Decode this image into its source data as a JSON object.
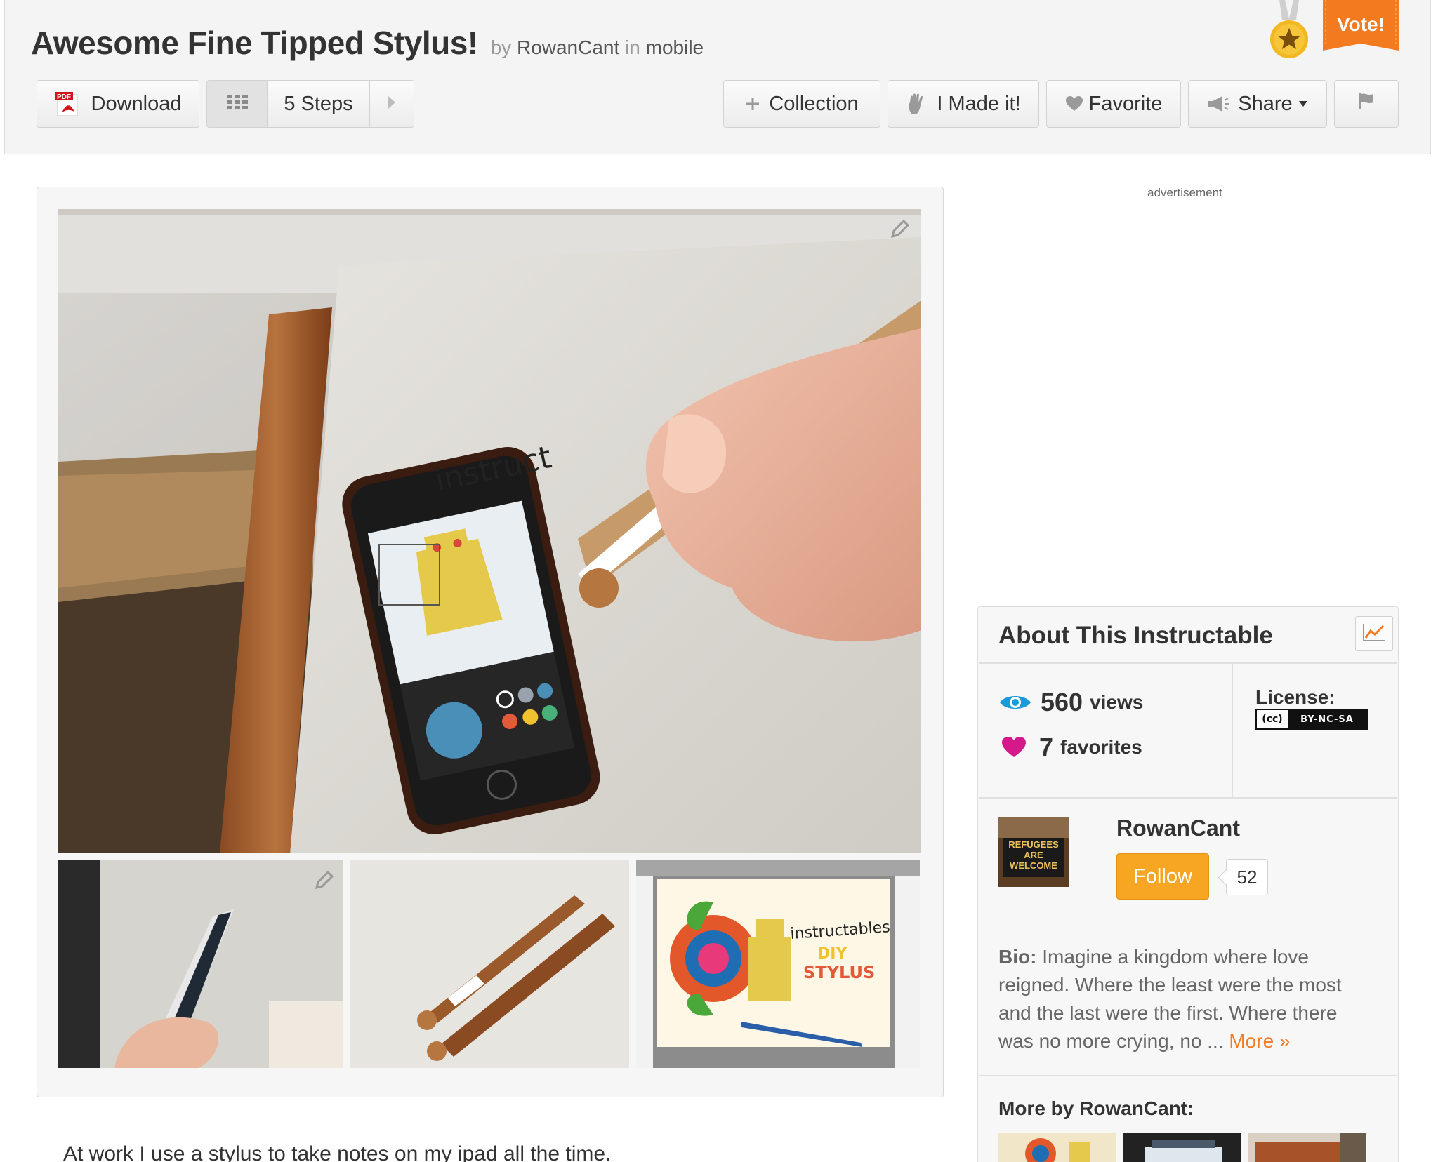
{
  "header": {
    "title": "Awesome Fine Tipped Stylus!",
    "by": "by",
    "author": "RowanCant",
    "in": "in",
    "category": "mobile",
    "vote_label": "Vote!"
  },
  "toolbar": {
    "download_label": "Download",
    "pdf_badge": "PDF",
    "steps_label": "5 Steps",
    "collection_label": "Collection",
    "made_it_label": "I Made it!",
    "favorite_label": "Favorite",
    "share_label": "Share"
  },
  "photos": {
    "main_screen_text": "instruct",
    "thumb3_text_1": "instructables",
    "thumb3_text_2": "DIY",
    "thumb3_text_3": "STYLUS"
  },
  "content": {
    "intro": "At work I use a stylus to take notes on my ipad all the time."
  },
  "sidebar": {
    "ad_label": "advertisement",
    "about_title": "About This Instructable",
    "views_count": "560",
    "views_label": "views",
    "favorites_count": "7",
    "favorites_label": "favorites",
    "license_label": "License:",
    "license_cc": "(cc)",
    "license_code": "BY-NC-SA",
    "author_name": "RowanCant",
    "avatar_text": "REFUGEES ARE WELCOME",
    "follow_label": "Follow",
    "follower_count": "52",
    "bio_label": "Bio:",
    "bio_text": "Imagine a kingdom where love reigned. Where the least were the most and the last were the first. Where there was no more crying, no ...",
    "bio_more": "More »",
    "more_by": "More by RowanCant:"
  },
  "colors": {
    "accent_orange": "#f47a20",
    "follow_orange": "#f6a623",
    "views_blue": "#1a9ad6",
    "favorite_pink": "#d6198a"
  }
}
